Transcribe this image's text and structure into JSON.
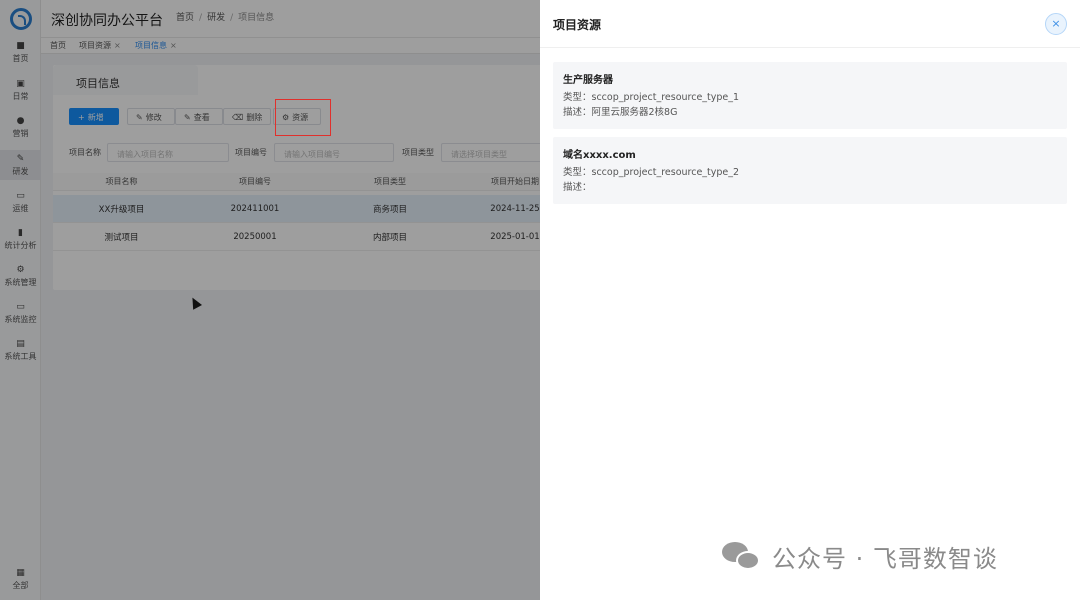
{
  "app": {
    "title": "深创协同办公平台"
  },
  "breadcrumb": [
    "首页",
    "研发",
    "项目信息"
  ],
  "rail": {
    "items": [
      {
        "label": "首页",
        "icon": "dashboard-icon"
      },
      {
        "label": "日常",
        "icon": "calendar-icon"
      },
      {
        "label": "营销",
        "icon": "globe-icon"
      },
      {
        "label": "研发",
        "icon": "edit-icon"
      },
      {
        "label": "运维",
        "icon": "monitor-icon"
      },
      {
        "label": "统计分析",
        "icon": "chart-icon"
      },
      {
        "label": "系统管理",
        "icon": "gear-icon"
      },
      {
        "label": "系统监控",
        "icon": "monitor-icon"
      },
      {
        "label": "系统工具",
        "icon": "toolbox-icon"
      }
    ],
    "bottom": {
      "label": "全部",
      "icon": "grid-icon"
    }
  },
  "tags": [
    {
      "label": "首页"
    },
    {
      "label": "项目资源"
    },
    {
      "label": "项目信息"
    }
  ],
  "page": {
    "tab_title": "项目信息"
  },
  "toolbar": {
    "add": "新增",
    "edit": "修改",
    "view": "查看",
    "delete": "删除",
    "resource": "资源"
  },
  "filters": {
    "name_label": "项目名称",
    "name_placeholder": "请输入项目名称",
    "code_label": "项目编号",
    "code_placeholder": "请输入项目编号",
    "type_label": "项目类型",
    "type_placeholder": "请选择项目类型"
  },
  "table": {
    "columns": [
      "项目名称",
      "项目编号",
      "项目类型",
      "项目开始日期"
    ],
    "rows": [
      [
        "XX升级项目",
        "202411001",
        "商务项目",
        "2024-11-25"
      ],
      [
        "测试项目",
        "20250001",
        "内部项目",
        "2025-01-01"
      ]
    ]
  },
  "drawer": {
    "title": "项目资源",
    "close_label": "×",
    "resources": [
      {
        "name": "生产服务器",
        "type_line": "类型：sccop_project_resource_type_1",
        "desc_line": "描述：阿里云服务器2核8G"
      },
      {
        "name": "域名xxxx.com",
        "type_line": "类型：sccop_project_resource_type_2",
        "desc_line": "描述："
      }
    ]
  },
  "watermark": {
    "text": "公众号 · 飞哥数智谈",
    "icon": "wechat-icon"
  },
  "colors": {
    "primary": "#1890ff",
    "highlight": "#e0302c",
    "accent": "#2d8cf0"
  }
}
